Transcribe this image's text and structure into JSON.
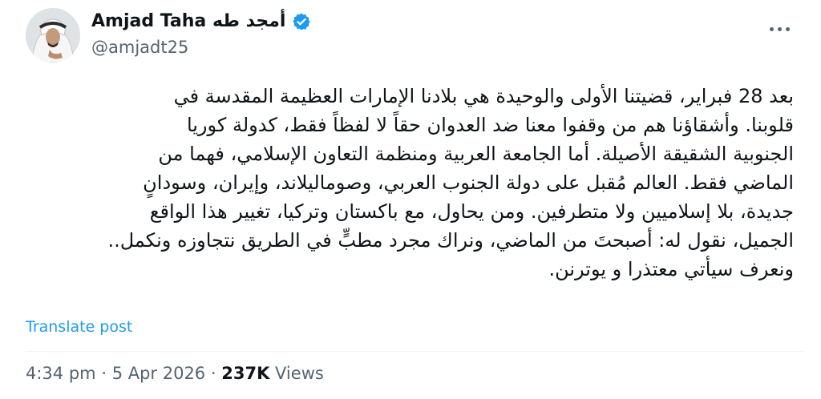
{
  "author": {
    "display_name": "Amjad Taha أمجد طه",
    "handle": "@amjadt25",
    "verified": true
  },
  "tweet": {
    "lines": [
      "بعد 28 فبراير، قضيتنا الأولى والوحيدة هي بلادنا الإمارات العظيمة المقدسة في",
      "قلوبنا. وأشقاؤنا هم من وقفوا معنا ضد العدوان حقاً لا لفظاً فقط، كدولة كوريا",
      "الجنوبية الشقيقة الأصيلة. أما الجامعة العربية ومنظمة التعاون الإسلامي، فهما من",
      "الماضي فقط. العالم مُقبل على  دولة الجنوب العربي، وصوماليلاند، وإيران، وسودانٍ",
      "جديدة، بلا إسلاميين ولا متطرفين. ومن يحاول، مع باكستان وتركيا، تغيير هذا الواقع",
      "الجميل، نقول له: أصبحتَ من الماضي، ونراك مجرد مطبٍّ في الطريق نتجاوزه ونكمل..",
      "ونعرف سيأتي معتذرا و يوترنن."
    ],
    "translate_label": "Translate post",
    "time": "4:34 pm",
    "separator": "·",
    "date": "5 Apr 2026",
    "views_count": "237K",
    "views_label": "Views"
  },
  "icons": {
    "more": "more-horizontal-icon",
    "verified": "verified-badge-icon"
  },
  "colors": {
    "accent": "#1d9bf0",
    "text": "#0f1419",
    "secondary": "#536471"
  }
}
